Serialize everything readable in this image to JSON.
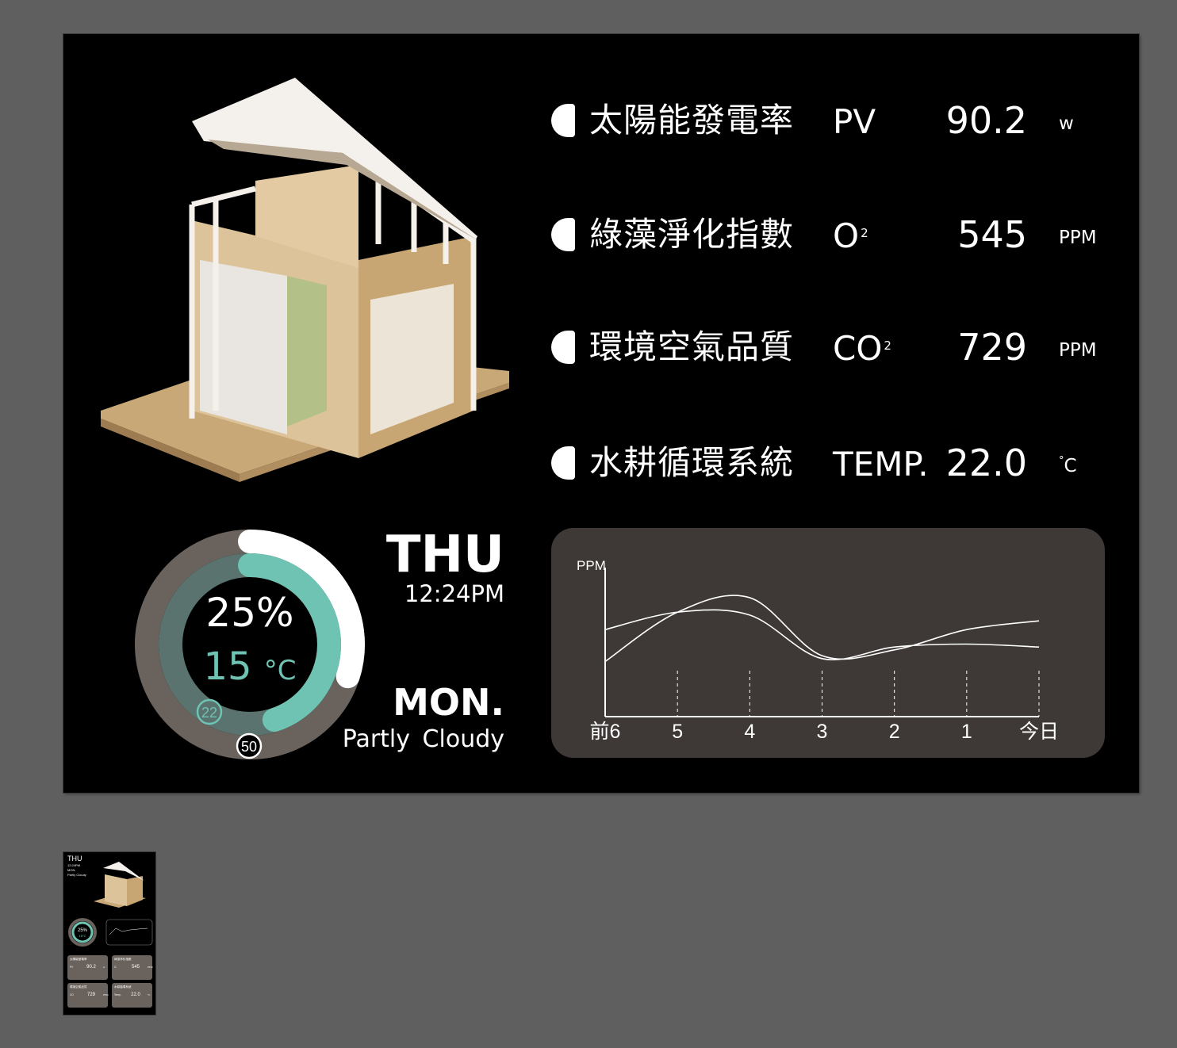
{
  "metrics": [
    {
      "label": "太陽能發電率",
      "symbol": "PV",
      "sup": "",
      "value": "90.2",
      "unit": "w",
      "unit_sup": ""
    },
    {
      "label": "綠藻淨化指數",
      "symbol": "O",
      "sup": "2",
      "value": "545",
      "unit": "PPM",
      "unit_sup": ""
    },
    {
      "label": "環境空氣品質",
      "symbol": "CO",
      "sup": "2",
      "value": "729",
      "unit": "PPM",
      "unit_sup": ""
    },
    {
      "label": "水耕循環系統",
      "symbol": "TEMP.",
      "sup": "",
      "value": "22.0",
      "unit": "C",
      "unit_sup": "°"
    }
  ],
  "gauge": {
    "percent_text": "25%",
    "temp_value": "15",
    "temp_unit": "°C",
    "inner_marker": "22",
    "outer_marker": "50",
    "outer_level": 0.3,
    "inner_level": 0.45,
    "accent": "#6fc3b2"
  },
  "datetime": {
    "day_top": "THU",
    "time": "12:24PM",
    "day_bottom": "MON.",
    "weather": "Partly Cloudy"
  },
  "chart_data": {
    "type": "line",
    "ylabel": "PPM",
    "categories": [
      "前6",
      "5",
      "4",
      "3",
      "2",
      "1",
      "今日"
    ],
    "series": [
      {
        "values": [
          0.38,
          0.72,
          0.82,
          0.42,
          0.46,
          0.6,
          0.66
        ]
      },
      {
        "values": [
          0.6,
          0.72,
          0.7,
          0.4,
          0.48,
          0.5,
          0.48
        ]
      }
    ],
    "ylim": [
      0,
      1
    ]
  },
  "thumbnail": {
    "day_top": "THU",
    "time": "12:24PM",
    "day_bottom": "MON.",
    "weather": "Partly Cloudy",
    "gauge_pct": "25%",
    "gauge_temp": "15°C",
    "cards": [
      {
        "title": "太陽能發電率",
        "sym": "PV",
        "val": "90.2",
        "unit": "w"
      },
      {
        "title": "綠藻淨化指數",
        "sym": "O",
        "val": "545",
        "unit": "PPM"
      },
      {
        "title": "環境空氣品質",
        "sym": "CO",
        "val": "729",
        "unit": "PPM"
      },
      {
        "title": "水耕循環系統",
        "sym": "Temp.",
        "val": "22.0",
        "unit": "°C"
      }
    ]
  }
}
